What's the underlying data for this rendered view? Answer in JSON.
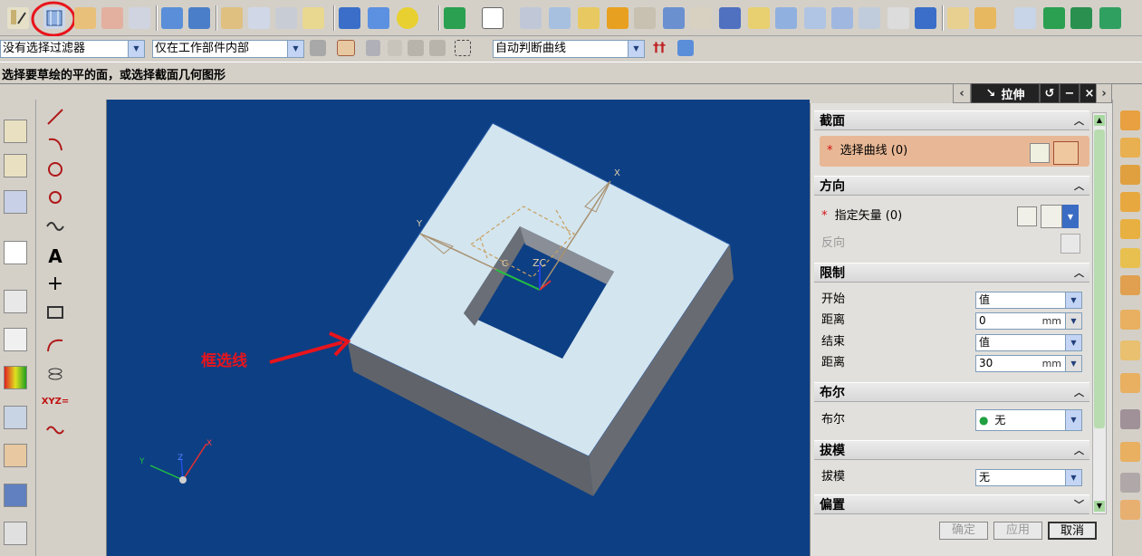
{
  "toolbar2": {
    "filter_value": "没有选择过滤器",
    "scope_value": "仅在工作部件内部",
    "curve_rule_value": "自动判断曲线"
  },
  "cue_line": {
    "text": "选择要草绘的平的面，或选择截面几何图形"
  },
  "viewport": {
    "annotation_text": "框选线",
    "annotation_color": "#e8141c",
    "background_color": "#0d3f84",
    "wcs_labels": {
      "x": "X",
      "y": "Y",
      "zc": "ZC",
      "c": "C"
    }
  },
  "dialog": {
    "title": "拉伸",
    "sections": {
      "section": {
        "title": "截面",
        "select_curve_label": "选择曲线 (0)"
      },
      "direction": {
        "title": "方向",
        "specify_vector_label": "指定矢量 (0)",
        "reverse_label": "反向"
      },
      "limits": {
        "title": "限制",
        "start_label": "开始",
        "start_value": "值",
        "start_distance_label": "距离",
        "start_distance_value": "0",
        "end_label": "结束",
        "end_value": "值",
        "end_distance_label": "距离",
        "end_distance_value": "30",
        "unit": "mm"
      },
      "boolean": {
        "title": "布尔",
        "label": "布尔",
        "value": "无"
      },
      "draft": {
        "title": "拔模",
        "label": "拔模",
        "value": "无"
      },
      "offset": {
        "title": "偏置"
      }
    },
    "buttons": {
      "ok": "确定",
      "apply": "应用",
      "cancel": "取消"
    }
  },
  "left_toolbar": {
    "text_tool_label": "A",
    "xyz_label": "XYZ="
  },
  "colors": {
    "highlight_circle": "#e8141c",
    "required_field_bg": "#e8b896",
    "accent_blue": "#3b6cc4"
  }
}
